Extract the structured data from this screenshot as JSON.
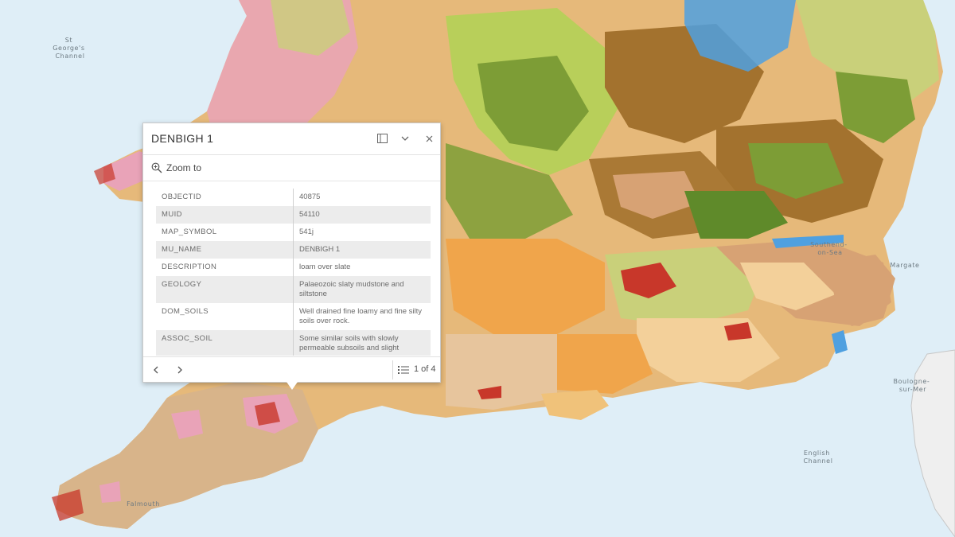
{
  "map": {
    "places": [
      {
        "name": "St George's Channel",
        "lines": [
          "St",
          "George's",
          "Channel"
        ]
      },
      {
        "name": "Southend-on-Sea",
        "lines": [
          "Southend-",
          "on-Sea"
        ]
      },
      {
        "name": "Margate",
        "lines": [
          "Margate"
        ]
      },
      {
        "name": "Boulogne-sur-Mer",
        "lines": [
          "Boulogne-",
          "sur-Mer"
        ]
      },
      {
        "name": "English Channel",
        "lines": [
          "English",
          "Channel"
        ]
      },
      {
        "name": "Falmouth",
        "lines": [
          "Falmouth"
        ]
      }
    ],
    "colors": {
      "sea": "#dfeef7",
      "land_base": "#e6b97a",
      "green": "#7d9d36",
      "lightgreen": "#b8cf5a",
      "brown": "#a3722e",
      "orange": "#f0a54b",
      "pink": "#e9a3b8",
      "blue": "#4fa0e0",
      "red": "#c8372a",
      "tan": "#d8b48a",
      "france": "#efefef"
    }
  },
  "popup": {
    "title": "DENBIGH 1",
    "zoom_label": "Zoom to",
    "rows": [
      {
        "key": "OBJECTID",
        "value": "40875"
      },
      {
        "key": "MUID",
        "value": "54110"
      },
      {
        "key": "MAP_SYMBOL",
        "value": "541j"
      },
      {
        "key": "MU_NAME",
        "value": "DENBIGH 1"
      },
      {
        "key": "DESCRIPTION",
        "value": "loam over slate"
      },
      {
        "key": "GEOLOGY",
        "value": "Palaeozoic slaty mudstone and siltstone"
      },
      {
        "key": "DOM_SOILS",
        "value": "Well drained fine loamy and fine silty soils over rock."
      },
      {
        "key": "ASSOC_SOIL",
        "value": "Some similar soils with slowly permeable subsoils and slight"
      }
    ],
    "pager": "1 of 4"
  }
}
